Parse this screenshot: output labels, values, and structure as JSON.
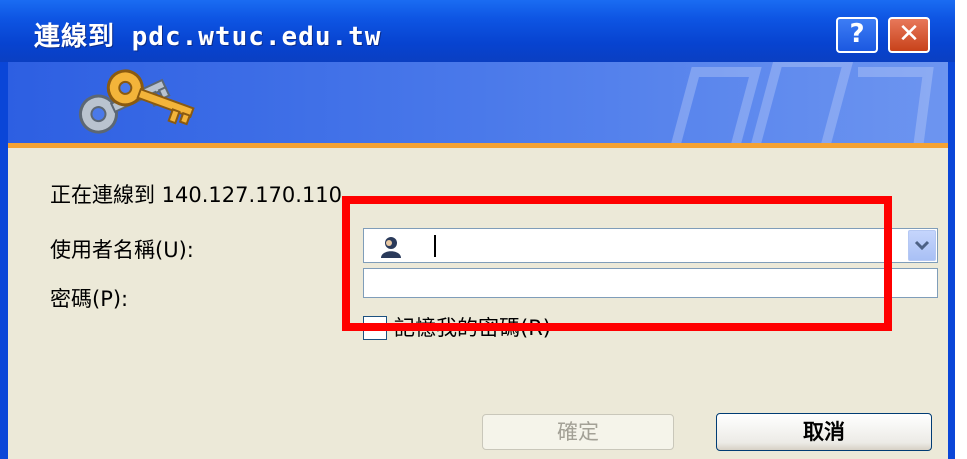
{
  "window": {
    "title": "連線到 pdc.wtuc.edu.tw",
    "help_label": "?",
    "close_label": "✕"
  },
  "banner": {
    "icon": "keys-icon"
  },
  "connect_text": "正在連線到 140.127.170.110",
  "username": {
    "label": "使用者名稱(U):",
    "value": "",
    "icon": "user-icon"
  },
  "password": {
    "label": "密碼(P):",
    "value": ""
  },
  "remember": {
    "label": "記憶我的密碼(R)",
    "checked": false
  },
  "buttons": {
    "ok_label": "確定",
    "ok_enabled": false,
    "cancel_label": "取消"
  },
  "colors": {
    "titlebar": "#0a46d8",
    "dialog_bg": "#ece9d8",
    "highlight": "#ff0000",
    "accent_stripe": "#f4a233"
  }
}
